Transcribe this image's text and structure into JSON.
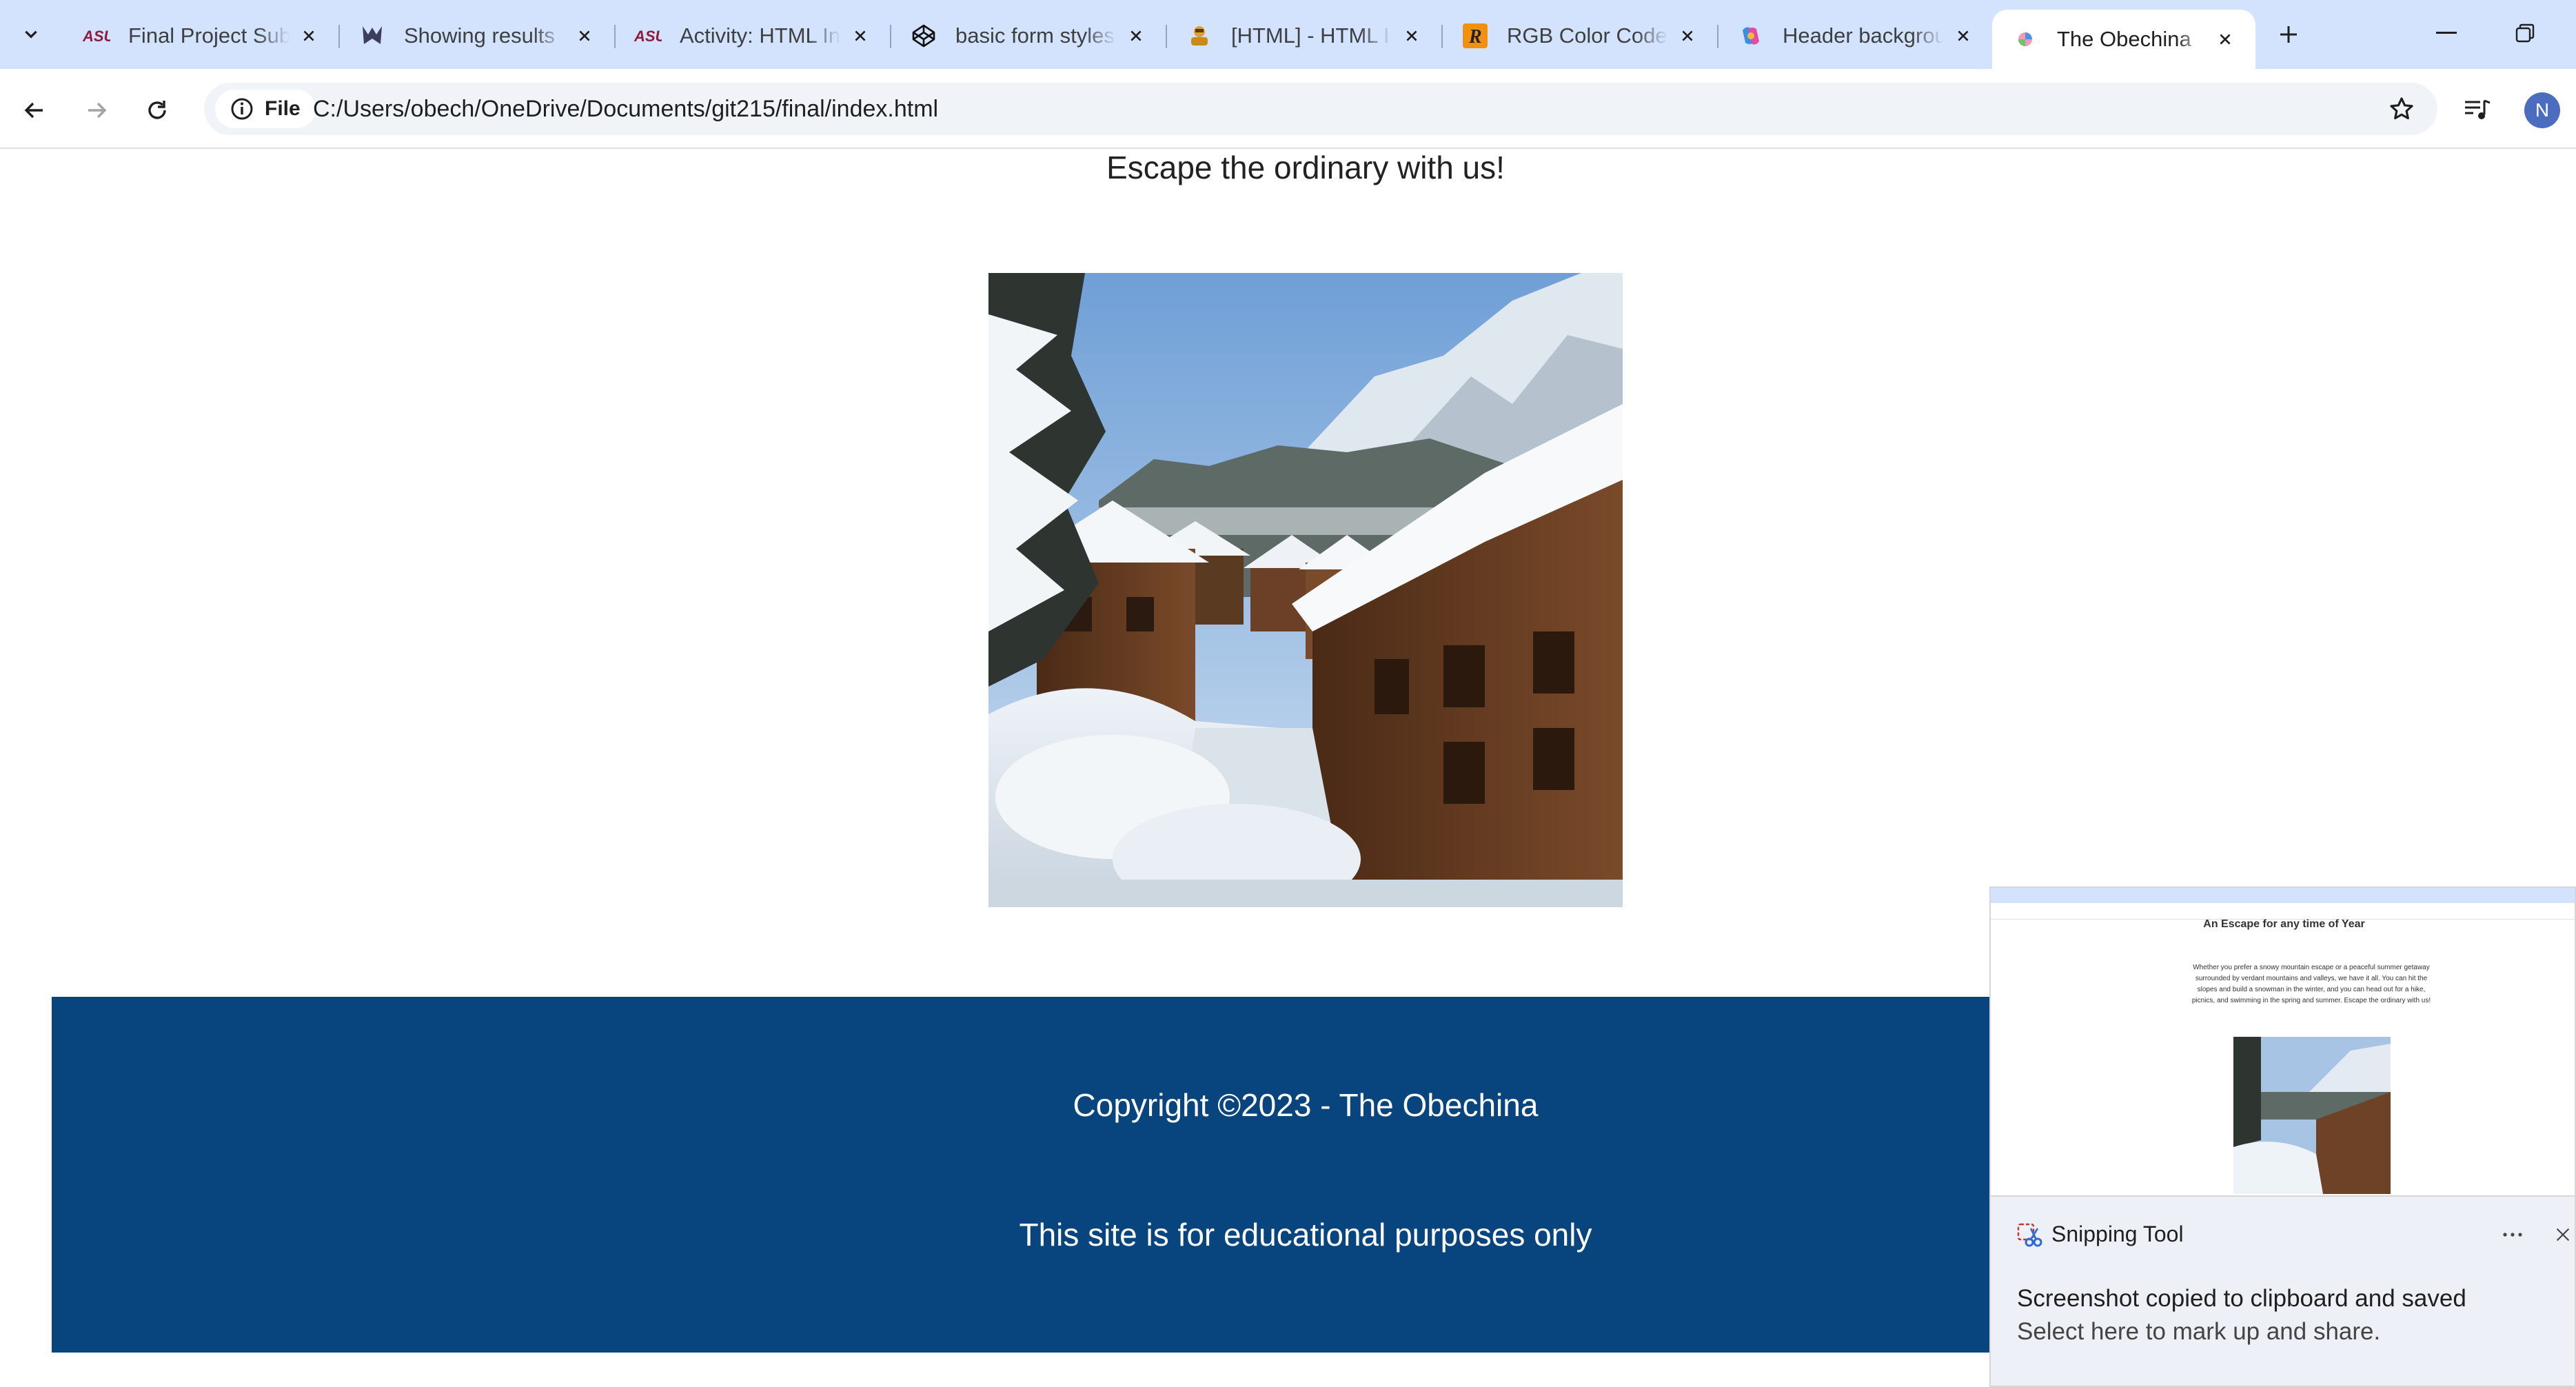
{
  "browser": {
    "tabs": [
      {
        "title": "Final Project Sub",
        "favicon": "asu-logo-icon"
      },
      {
        "title": "Showing results",
        "favicon": "wolf-logo-icon"
      },
      {
        "title": "Activity: HTML In",
        "favicon": "asu-logo-icon"
      },
      {
        "title": "basic form styles",
        "favicon": "codepen-icon"
      },
      {
        "title": "[HTML] - HTML I",
        "favicon": "reference-icon"
      },
      {
        "title": "RGB Color Code",
        "favicon": "rapidtables-icon"
      },
      {
        "title": "Header backgrou",
        "favicon": "copilot-icon"
      },
      {
        "title": "The Obechina",
        "favicon": "page-icon",
        "active": true
      }
    ],
    "address_chip": "File",
    "url": "C:/Users/obech/OneDrive/Documents/git215/final/index.html",
    "profile_initial": "N",
    "accent_color": "#d3e3fd"
  },
  "page": {
    "tagline": "Escape the ordinary with us!",
    "hero_image": "snowy-alpine-village",
    "footer": {
      "background": "#08457e",
      "copyright": "Copyright ©2023 - The Obechina",
      "disclaimer": "This site is for educational purposes only"
    }
  },
  "notification": {
    "app": "Snipping Tool",
    "title": "Screenshot copied to clipboard and saved",
    "subtitle": "Select here to mark up and share.",
    "preview": {
      "heading": "An Escape for any time of Year",
      "paragraph": "Whether you prefer a snowy mountain escape or a peaceful summer getaway surrounded by verdant mountains and valleys, we have it all. You can hit the slopes and build a snowman in the winter, and you can head out for a hike, picnics, and swimming in the spring and summer. Escape the ordinary with us!"
    }
  }
}
